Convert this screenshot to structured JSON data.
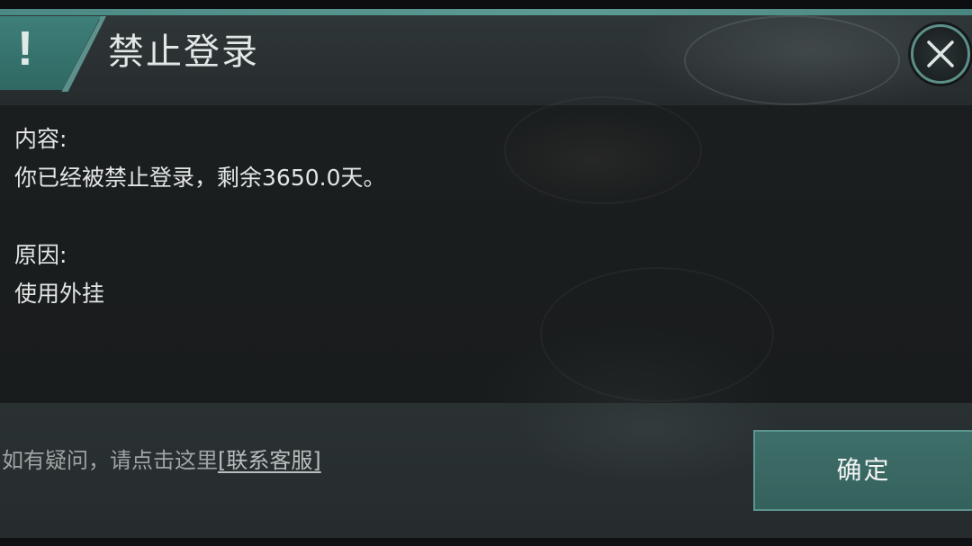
{
  "dialog": {
    "title": "禁止登录",
    "warning_icon": "exclamation-icon",
    "close_icon": "close-icon",
    "content_label": "内容:",
    "content_text": "你已经被禁止登录，剩余3650.0天。",
    "reason_label": "原因:",
    "reason_text": "使用外挂",
    "help_prefix": "如有疑问，请点击这里",
    "help_link": "[联系客服]",
    "confirm_label": "确定"
  },
  "colors": {
    "accent": "#4b8a84",
    "button": "#3f6f6a",
    "text": "#e3e6e5"
  }
}
